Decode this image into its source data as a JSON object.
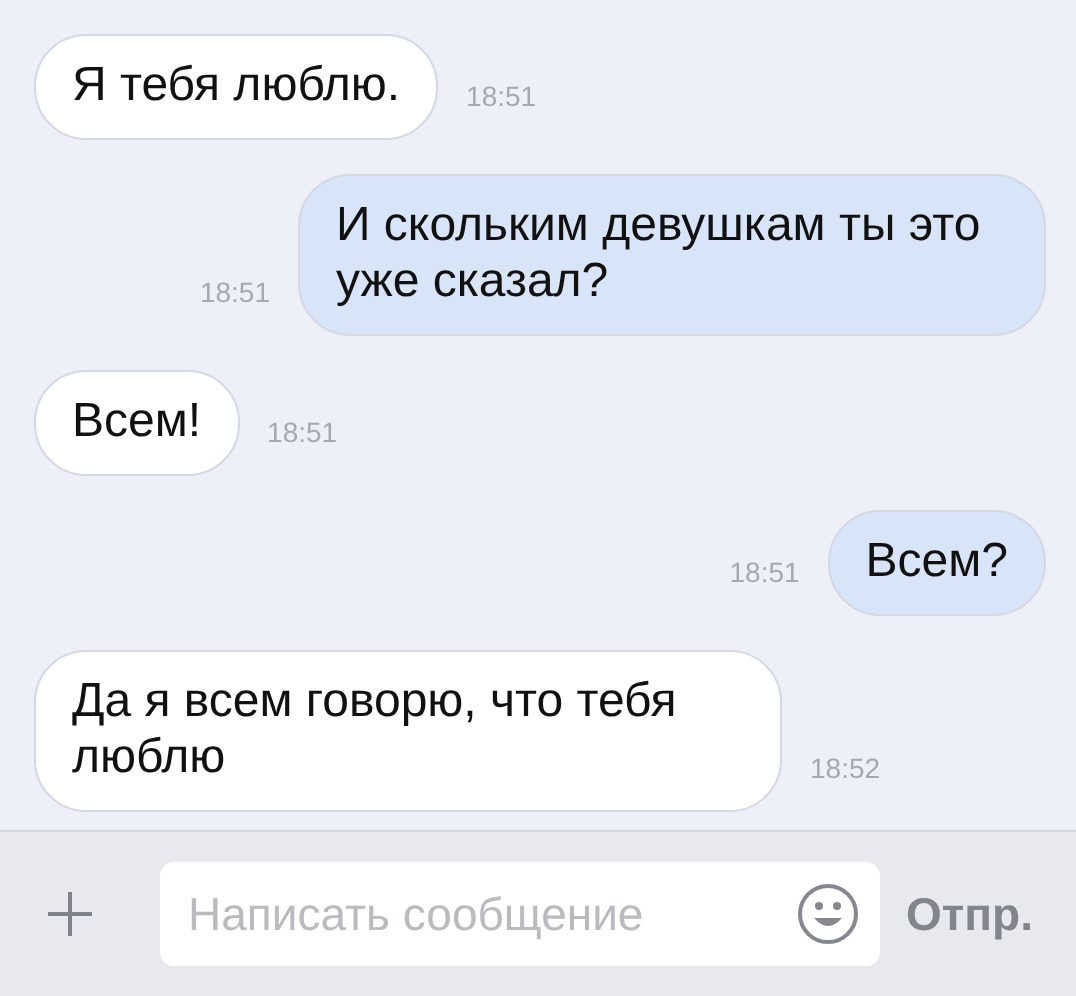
{
  "messages": [
    {
      "kind": "incoming",
      "text": "Я тебя люблю.",
      "time": "18:51"
    },
    {
      "kind": "outgoing",
      "text": "И скольким девушкам ты это уже сказал?",
      "time": "18:51"
    },
    {
      "kind": "incoming",
      "text": "Всем!",
      "time": "18:51"
    },
    {
      "kind": "outgoing",
      "text": "Всем?",
      "time": "18:51"
    },
    {
      "kind": "incoming",
      "text": "Да я всем говорю, что тебя люблю",
      "time": "18:52"
    }
  ],
  "composer": {
    "placeholder": "Написать сообщение",
    "send_label": "Отпр."
  }
}
